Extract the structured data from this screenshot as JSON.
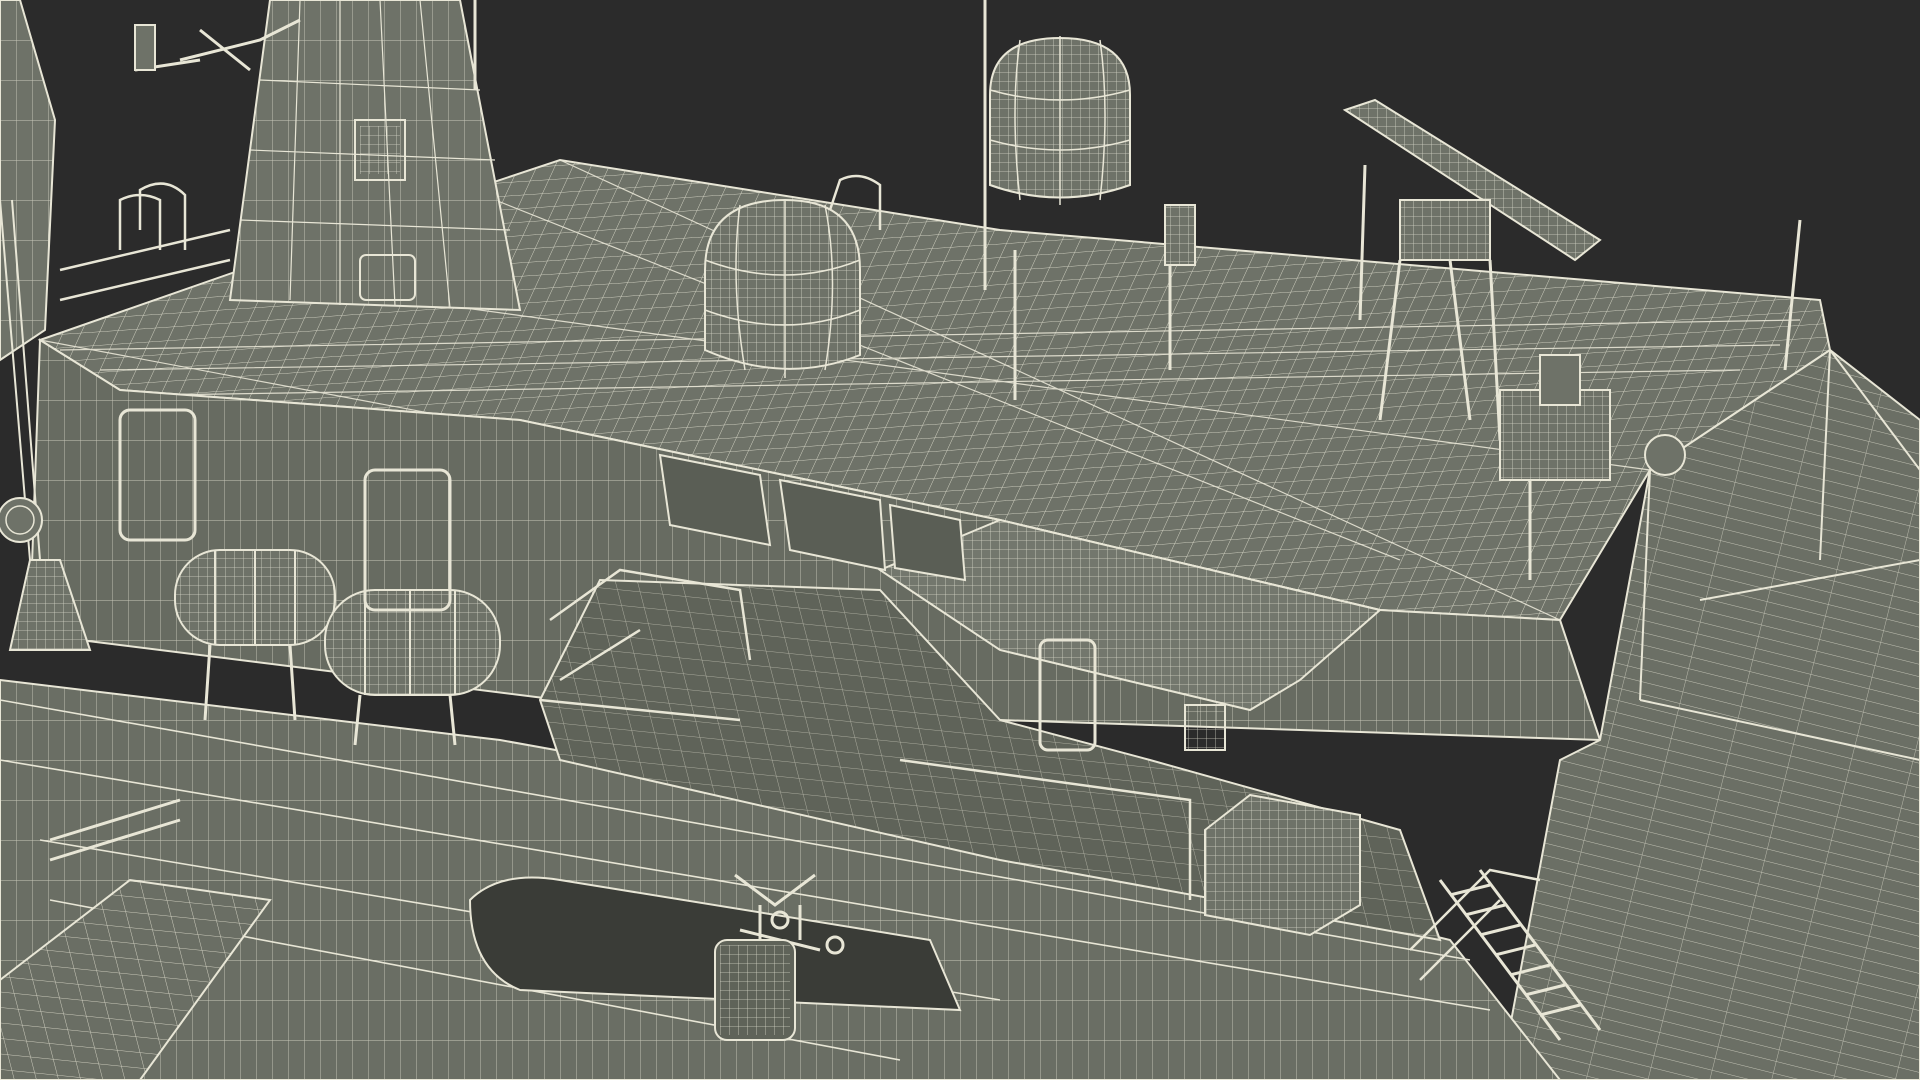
{
  "scene": {
    "background_color": "#2b2b2b",
    "surface_color": "#6e7268",
    "surface_dark": "#5f6359",
    "surface_light": "#7c8075",
    "wire_color": "#e8e6d6",
    "wire_color_dim": "#c9c7b8"
  }
}
